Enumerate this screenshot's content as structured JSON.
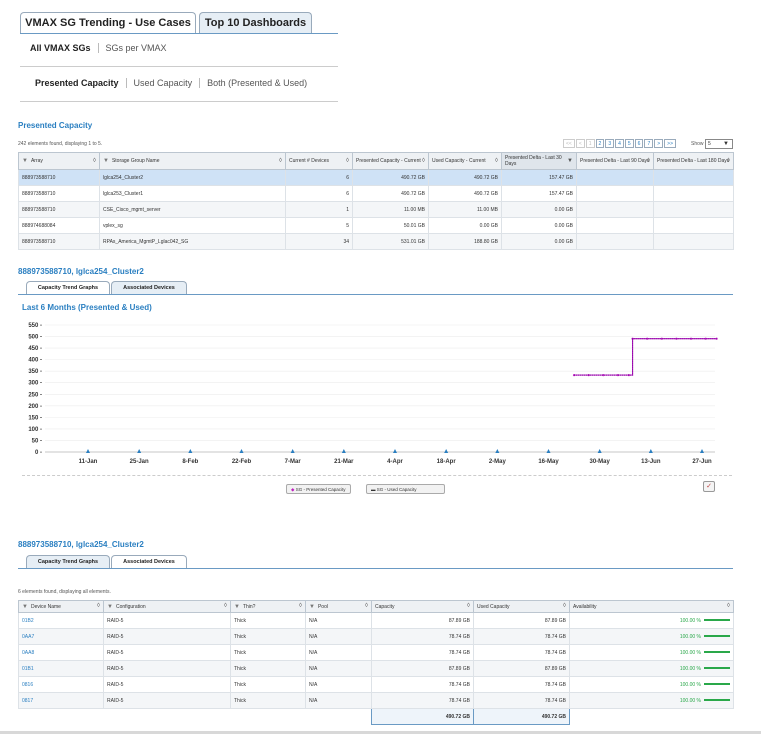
{
  "tabs": [
    {
      "label": "VMAX SG Trending - Use Cases"
    },
    {
      "label": "Top 10 Dashboards"
    }
  ],
  "subnav1": [
    "All VMAX SGs",
    "SGs per VMAX"
  ],
  "subnav2": [
    "Presented Capacity",
    "Used Capacity",
    "Both (Presented & Used)"
  ],
  "presented": {
    "title": "Presented Capacity",
    "info": "242 elements found, displaying 1 to 5.",
    "pager": [
      "<<",
      "<",
      "1",
      "2",
      "3",
      "4",
      "5",
      "6",
      "7",
      ">",
      ">>"
    ],
    "show_label": "Show",
    "show_value": "5",
    "columns": [
      "Array",
      "Storage Group Name",
      "Current # Devices",
      "Presented Capacity - Current",
      "Used Capacity - Current",
      "Presented Delta - Last 30 Days",
      "Presented Delta - Last 90 Days",
      "Presented Delta - Last 180 Days"
    ],
    "rows": [
      [
        "888973588710",
        "lglca254_Cluster2",
        "6",
        "490.72 GB",
        "490.72 GB",
        "157.47 GB",
        "",
        ""
      ],
      [
        "888973588710",
        "lglca253_Cluster1",
        "6",
        "490.72 GB",
        "490.72 GB",
        "157.47 GB",
        "",
        ""
      ],
      [
        "888973588710",
        "CSE_Cisco_mgmt_server",
        "1",
        "11.00 MB",
        "11.00 MB",
        "0.00 GB",
        "",
        ""
      ],
      [
        "888974688084",
        "vplex_sg",
        "5",
        "50.01 GB",
        "0.00 GB",
        "0.00 GB",
        "",
        ""
      ],
      [
        "888973588710",
        "RPAs_America_MgmtP_Lglac042_SG",
        "34",
        "531.01 GB",
        "188.80 GB",
        "0.00 GB",
        "",
        ""
      ]
    ]
  },
  "detail1": {
    "title": "888973588710, lglca254_Cluster2",
    "tabs": [
      "Capacity Trend Graphs",
      "Associated Devices"
    ]
  },
  "chart_title": "Last 6 Months (Presented & Used)",
  "chart_data": {
    "type": "line",
    "title": "Last 6 Months (Presented & Used)",
    "x_ticks": [
      "11-Jan",
      "25-Jan",
      "8-Feb",
      "22-Feb",
      "7-Mar",
      "21-Mar",
      "4-Apr",
      "18-Apr",
      "2-May",
      "16-May",
      "30-May",
      "13-Jun",
      "27-Jun"
    ],
    "y_ticks": [
      "550 -",
      "500 -",
      "450 -",
      "400 -",
      "350 -",
      "300 -",
      "250 -",
      "200 -",
      "150 -",
      "100 -",
      "50 -",
      "0 -"
    ],
    "ylim": [
      0,
      550
    ],
    "series": [
      {
        "name": "SG - Presented Capacity",
        "color": "#c020c0",
        "points": [
          [
            "2017-05-24",
            333
          ],
          [
            "2017-05-28",
            333
          ],
          [
            "2017-06-01",
            333
          ],
          [
            "2017-06-05",
            333
          ],
          [
            "2017-06-08",
            333
          ],
          [
            "2017-06-09",
            490.72
          ],
          [
            "2017-06-13",
            490.72
          ],
          [
            "2017-06-17",
            490.72
          ],
          [
            "2017-06-21",
            490.72
          ],
          [
            "2017-06-25",
            490.72
          ],
          [
            "2017-06-29",
            490.72
          ],
          [
            "2017-07-02",
            490.72
          ]
        ]
      },
      {
        "name": "SG - Used Capacity",
        "color": "#333333",
        "points": [
          [
            "2017-05-24",
            333
          ],
          [
            "2017-05-28",
            333
          ],
          [
            "2017-06-01",
            333
          ],
          [
            "2017-06-05",
            333
          ],
          [
            "2017-06-08",
            333
          ],
          [
            "2017-06-09",
            490.72
          ],
          [
            "2017-06-13",
            490.72
          ],
          [
            "2017-06-17",
            490.72
          ],
          [
            "2017-06-21",
            490.72
          ],
          [
            "2017-06-25",
            490.72
          ],
          [
            "2017-06-29",
            490.72
          ],
          [
            "2017-07-02",
            490.72
          ]
        ]
      }
    ]
  },
  "legend": [
    "SG - Presented Capacity",
    "SG - Used Capacity"
  ],
  "detail2": {
    "title": "888973588710, lglca254_Cluster2",
    "tabs": [
      "Capacity Trend Graphs",
      "Associated Devices"
    ],
    "info": "6 elements found, displaying all elements.",
    "columns": [
      "Device Name",
      "Configuration",
      "Thin?",
      "Pool",
      "Capacity",
      "Used Capacity",
      "Availability"
    ],
    "rows": [
      [
        "01B2",
        "RAID-5",
        "Thick",
        "N/A",
        "87.89 GB",
        "87.89 GB",
        "100.00 %"
      ],
      [
        "0AA7",
        "RAID-5",
        "Thick",
        "N/A",
        "78.74 GB",
        "78.74 GB",
        "100.00 %"
      ],
      [
        "0AA8",
        "RAID-5",
        "Thick",
        "N/A",
        "78.74 GB",
        "78.74 GB",
        "100.00 %"
      ],
      [
        "01B1",
        "RAID-5",
        "Thick",
        "N/A",
        "87.89 GB",
        "87.89 GB",
        "100.00 %"
      ],
      [
        "0816",
        "RAID-5",
        "Thick",
        "N/A",
        "78.74 GB",
        "78.74 GB",
        "100.00 %"
      ],
      [
        "0817",
        "RAID-5",
        "Thick",
        "N/A",
        "78.74 GB",
        "78.74 GB",
        "100.00 %"
      ]
    ],
    "totals": [
      "490.72 GB",
      "490.72 GB"
    ]
  }
}
